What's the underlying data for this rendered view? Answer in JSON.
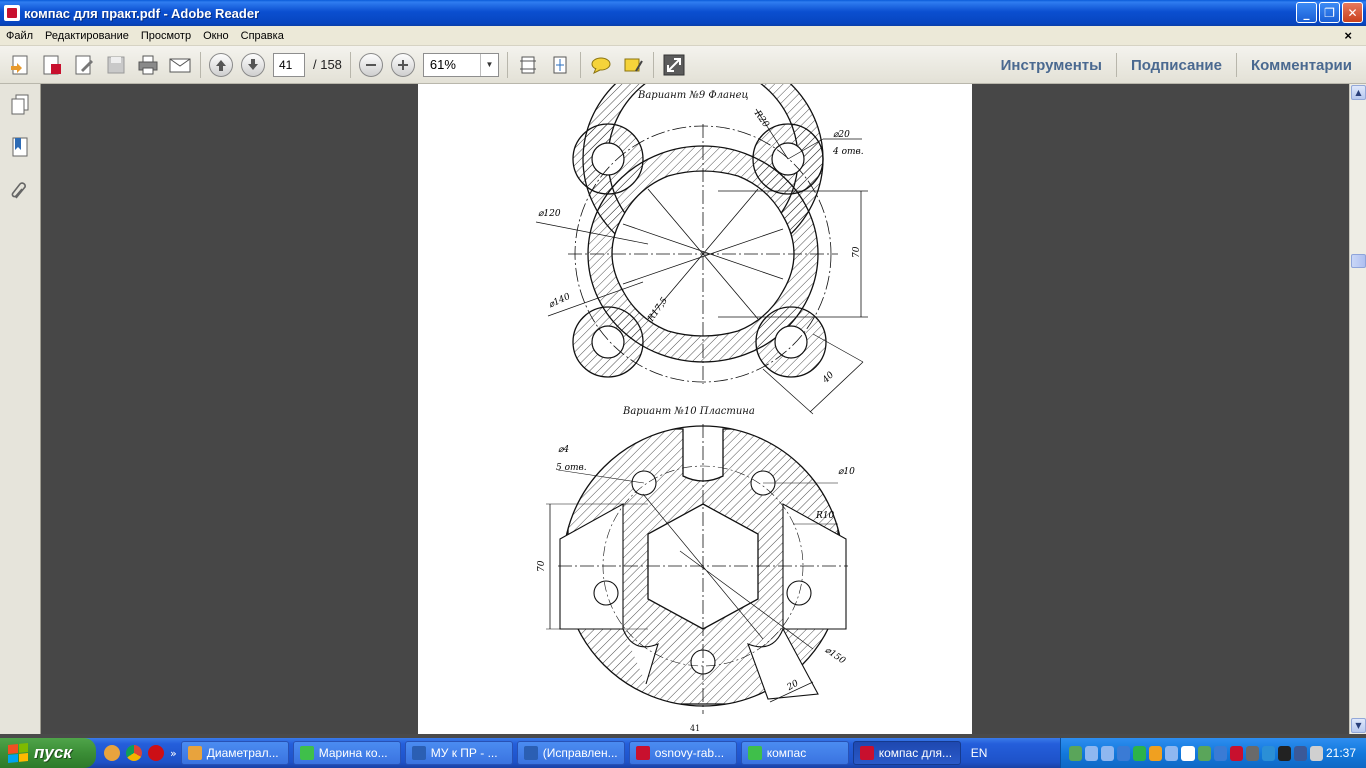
{
  "window": {
    "title": "компас для практ.pdf - Adobe Reader",
    "buttons": {
      "minimize": "_",
      "maximize": "❐",
      "close": "✕"
    }
  },
  "menu": {
    "items": [
      "Файл",
      "Редактирование",
      "Просмотр",
      "Окно",
      "Справка"
    ],
    "close_doc": "×"
  },
  "toolbar": {
    "page_current": "41",
    "page_total": "/ 158",
    "zoom": "61%",
    "right_tabs": [
      "Инструменты",
      "Подписание",
      "Комментарии"
    ]
  },
  "document": {
    "variant9_title": "Вариант №9   Фланец",
    "variant10_title": "Вариант №10   Пластина",
    "page_number": "41",
    "dim_v9": {
      "r20": "R20",
      "d20": "⌀20",
      "holes4": "4 отв.",
      "d120": "⌀120",
      "d140": "⌀140",
      "r175": "R17,5",
      "h70": "70",
      "w40": "40"
    },
    "dim_v10": {
      "d4": "⌀4",
      "holes5": "5 отв.",
      "d10": "⌀10",
      "r10": "R10",
      "h70": "70",
      "d150": "⌀150",
      "w20": "20"
    }
  },
  "taskbar": {
    "start_label": "пуск",
    "tasks": [
      {
        "label": "Диаметрал...",
        "color": "#e8a33d"
      },
      {
        "label": "Марина ко...",
        "color": "#3fbf4a"
      },
      {
        "label": "МУ к ПР - ...",
        "color": "#2b5fb3"
      },
      {
        "label": "(Исправлен...",
        "color": "#2b5fb3"
      },
      {
        "label": "osnovy-rab...",
        "color": "#c8102e"
      },
      {
        "label": "компас",
        "color": "#3fbf4a"
      },
      {
        "label": "компас для...",
        "color": "#c8102e"
      }
    ],
    "language": "EN",
    "clock": "21:37"
  }
}
